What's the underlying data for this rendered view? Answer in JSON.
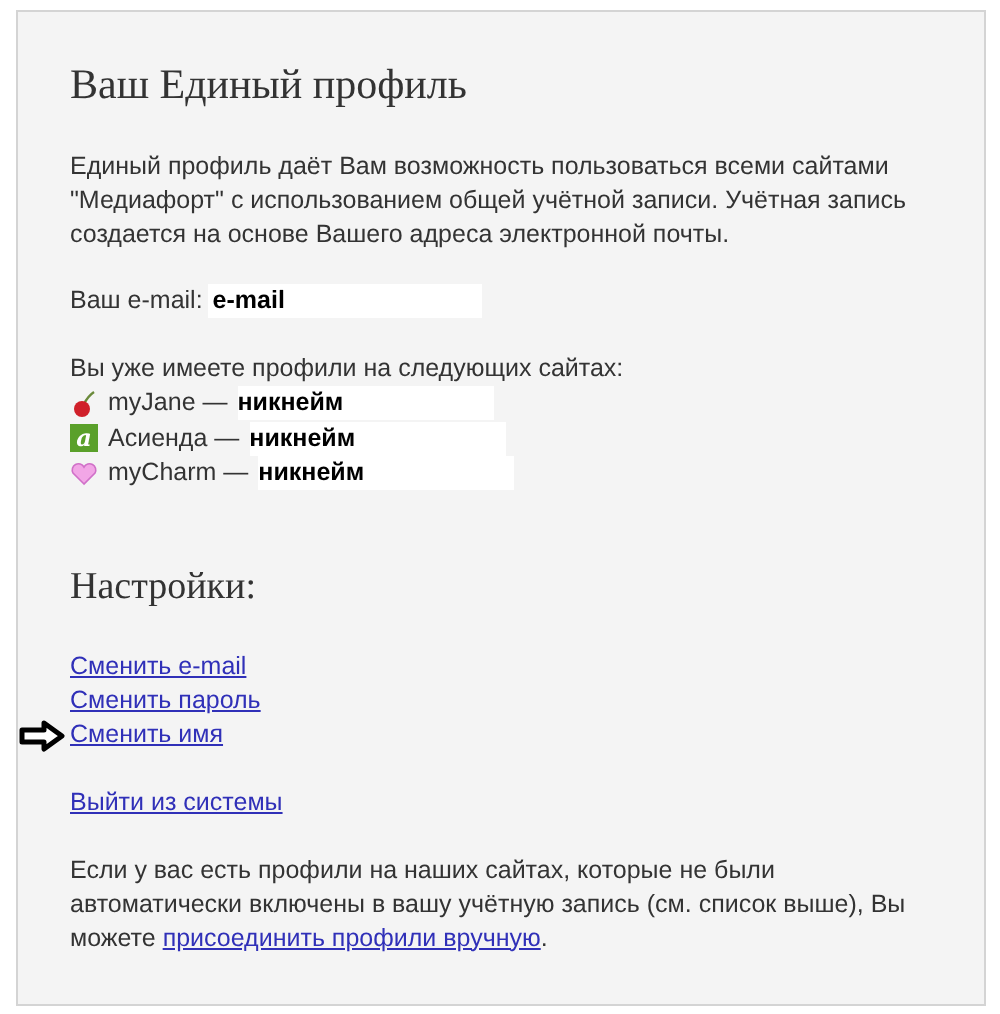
{
  "title": "Ваш Единый профиль",
  "intro": "Единый профиль даёт Вам возможность пользоваться всеми сайтами \"Медиафорт\" с использованием общей учётной записи. Учётная запись создается на основе Вашего адреса электронной почты.",
  "email": {
    "label": "Ваш e-mail:",
    "value": "e-mail"
  },
  "profiles_heading": "Вы уже имеете профили на следующих сайтах:",
  "sites": [
    {
      "kind": "cherry",
      "name": "myJane —",
      "nickname": "никнейм"
    },
    {
      "kind": "letter",
      "badge": "a",
      "name": "Асиенда —",
      "nickname": "никнейм"
    },
    {
      "kind": "heart",
      "name": "myCharm —",
      "nickname": "никнейм"
    }
  ],
  "settings_title": "Настройки:",
  "links": [
    {
      "label": "Сменить e-mail",
      "pointed": false
    },
    {
      "label": "Сменить пароль",
      "pointed": false
    },
    {
      "label": "Сменить имя",
      "pointed": true
    }
  ],
  "logout": "Выйти из системы",
  "footer": {
    "text": "Если у вас есть профили на наших сайтах, которые не были автоматически включены в вашу учётную запись (см. список выше), Вы можете",
    "link": "присоединить профили вручную",
    "end": "."
  }
}
